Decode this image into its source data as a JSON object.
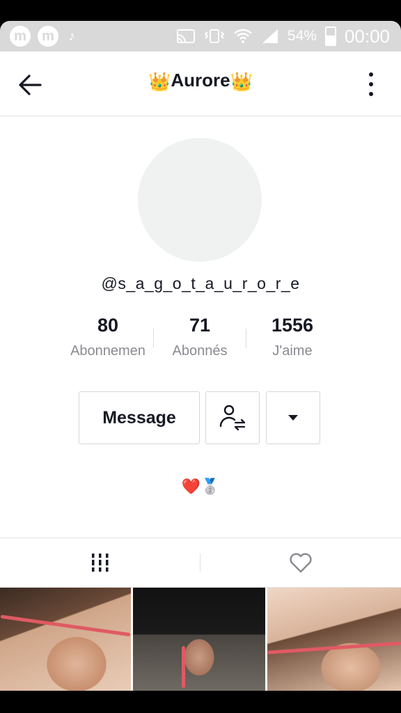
{
  "status_bar": {
    "left_icons": [
      "m",
      "m"
    ],
    "tiktok_icon": "tiktok-note-icon",
    "icons": [
      "cast-icon",
      "vibrate-icon",
      "wifi-icon",
      "signal-icon"
    ],
    "battery_percent": "54%",
    "time": "00:00"
  },
  "header": {
    "title": "Aurore",
    "title_decoration": "👑",
    "back_icon": "arrow-left-icon",
    "more_icon": "more-vertical-icon"
  },
  "profile": {
    "username": "@s_a_g_o_t_a_u_r_o_r_e",
    "stats": [
      {
        "value": "80",
        "label": "Abonnemen"
      },
      {
        "value": "71",
        "label": "Abonnés"
      },
      {
        "value": "1556",
        "label": "J'aime"
      }
    ],
    "buttons": {
      "message": "Message",
      "follow_icon": "user-swap-icon",
      "dropdown_icon": "caret-down-icon"
    },
    "bio": "❤️🥈"
  },
  "tabs": [
    {
      "icon": "grid-icon",
      "active": true
    },
    {
      "icon": "heart-outline-icon",
      "active": false
    }
  ],
  "colors": {
    "text_primary": "#161823",
    "text_secondary": "#8a8b91",
    "status_bar_bg": "#d9d9d9",
    "divider": "#e3e3e3"
  }
}
